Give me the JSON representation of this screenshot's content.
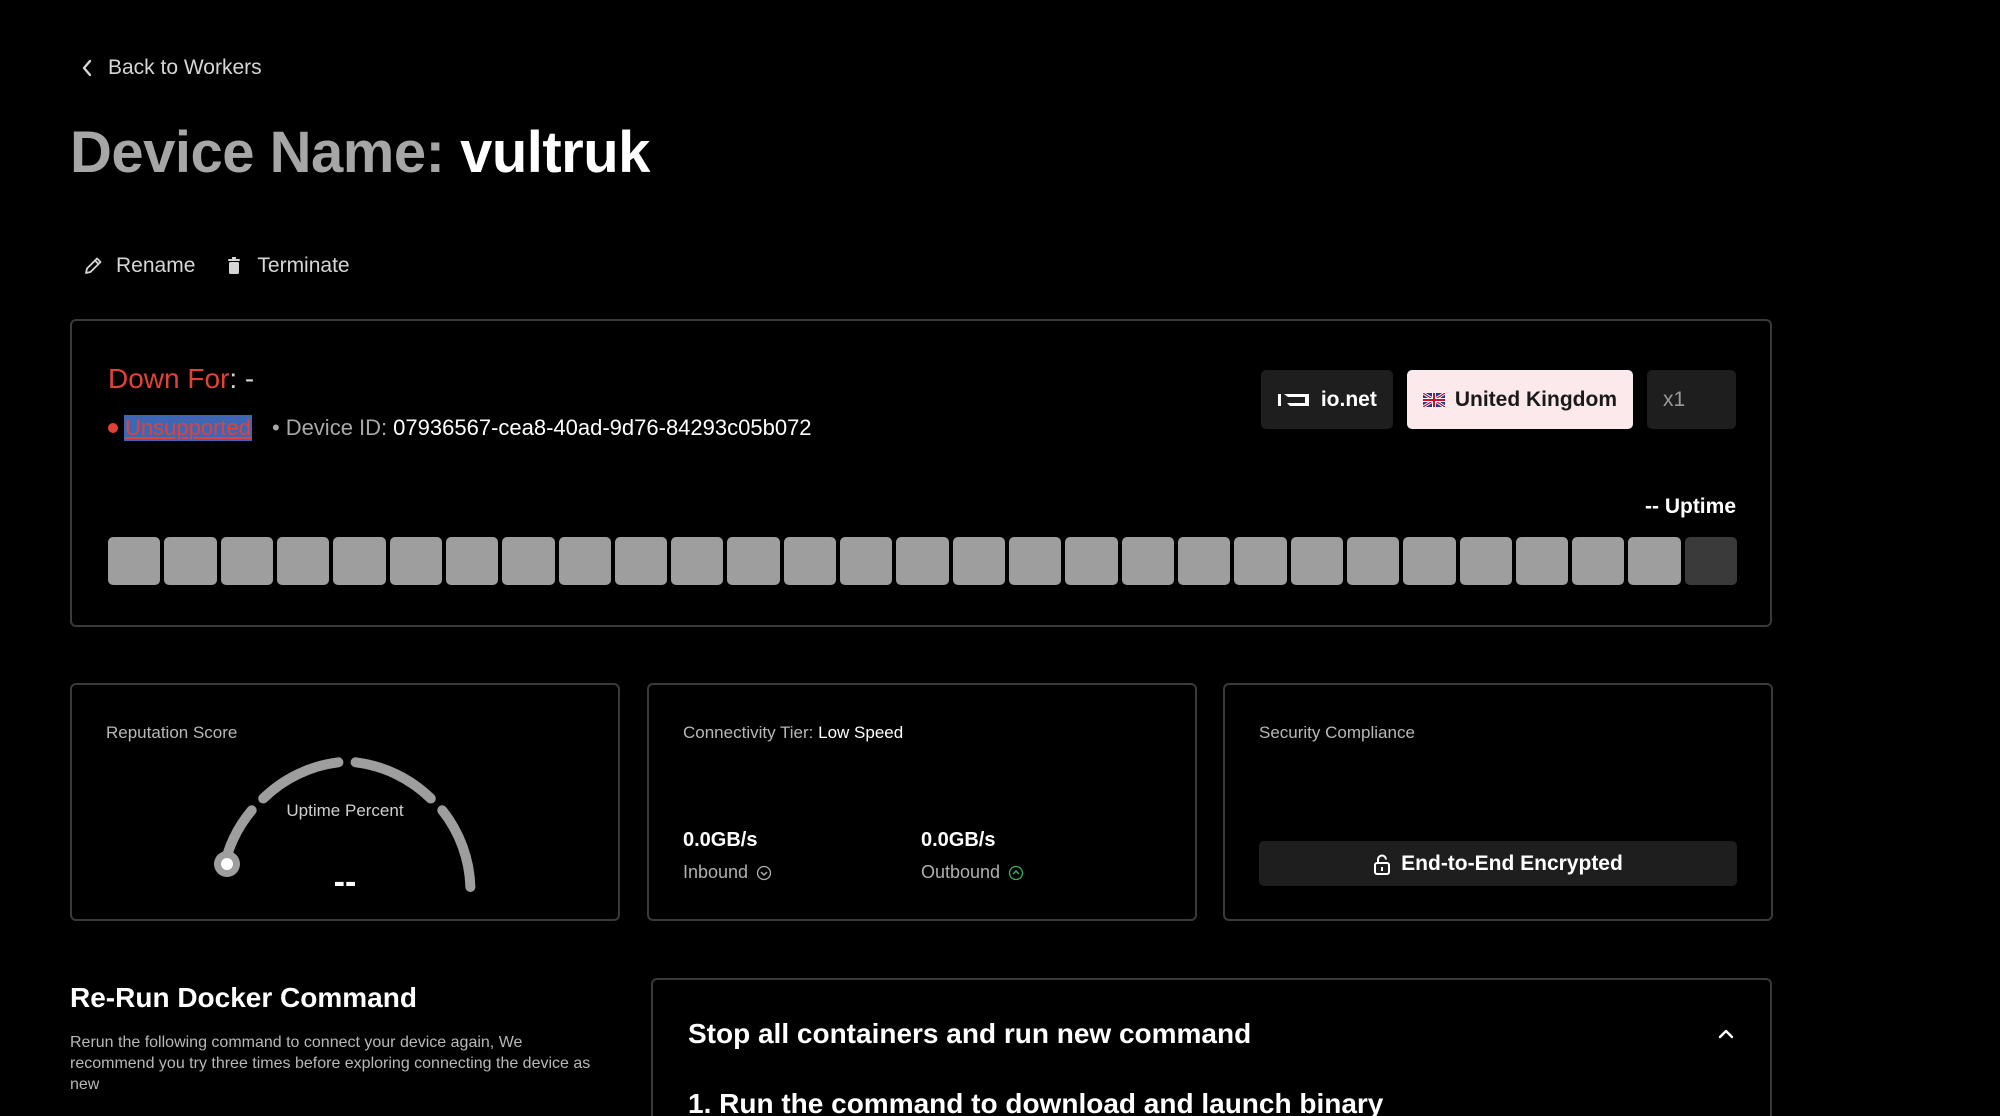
{
  "nav": {
    "back_label": "Back to Workers"
  },
  "device": {
    "title_label": "Device Name:",
    "name": "vultruk"
  },
  "actions": {
    "rename_label": "Rename",
    "terminate_label": "Terminate"
  },
  "status": {
    "down_for_label": "Down For",
    "down_for_colon": ":",
    "down_for_value": " -",
    "state": "Unsupported",
    "device_id_label": "Device ID:",
    "device_id": "07936567-cea8-40ad-9d76-84293c05b072"
  },
  "chips": {
    "network": "io.net",
    "country": "United Kingdom",
    "count": "x1"
  },
  "uptime": {
    "label": "-- Uptime",
    "bars": [
      1,
      1,
      1,
      1,
      1,
      1,
      1,
      1,
      1,
      1,
      1,
      1,
      1,
      1,
      1,
      1,
      1,
      1,
      1,
      1,
      1,
      1,
      1,
      1,
      1,
      1,
      1,
      1,
      0
    ]
  },
  "reputation": {
    "label": "Reputation Score",
    "gauge_title": "Uptime Percent",
    "gauge_value": "--"
  },
  "connectivity": {
    "label": "Connectivity Tier:",
    "tier": "Low Speed",
    "inbound_value": "0.0GB/s",
    "inbound_label": "Inbound",
    "outbound_value": "0.0GB/s",
    "outbound_label": "Outbound"
  },
  "security": {
    "label": "Security Compliance",
    "badge": "End-to-End Encrypted"
  },
  "rerun": {
    "title": "Re-Run Docker Command",
    "description": "Rerun the following command to connect your device again, We recommend you try three times before exploring connecting the device as new"
  },
  "command": {
    "header": "Stop all containers and run new command",
    "step1": "1. Run the command to download and launch binary"
  },
  "colors": {
    "error": "#e0423a",
    "accent_green": "#3fae5a",
    "card_border": "#3a3a3a"
  }
}
